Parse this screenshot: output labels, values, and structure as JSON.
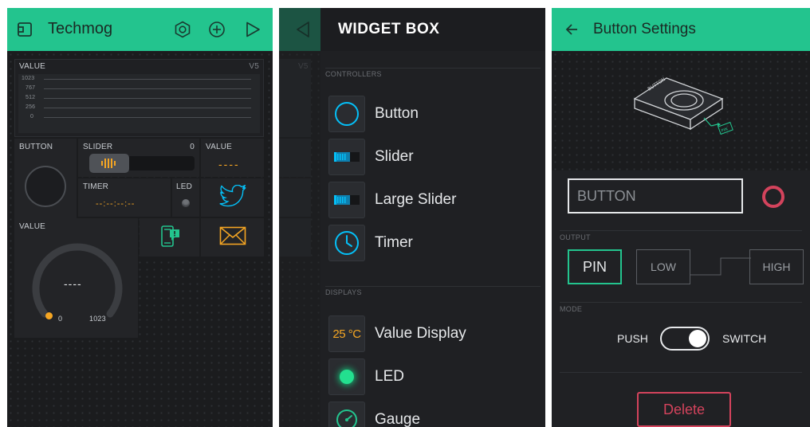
{
  "panel1": {
    "title": "Techmog",
    "value_chart": {
      "label": "VALUE",
      "pin": "V5",
      "ticks": [
        "1023",
        "767",
        "512",
        "256",
        "0"
      ]
    },
    "button_widget": {
      "label": "BUTTON"
    },
    "slider_widget": {
      "label": "SLIDER",
      "value": "0"
    },
    "value_small": {
      "label": "VALUE",
      "value": "----"
    },
    "timer_widget": {
      "label": "TIMER",
      "value": "--:--:--:--"
    },
    "led_widget": {
      "label": "LED"
    },
    "gauge_widget": {
      "label": "VALUE",
      "value": "----",
      "min": "0",
      "max": "1023"
    }
  },
  "panel2": {
    "title": "WIDGET BOX",
    "controllers_label": "CONTROLLERS",
    "controllers": [
      {
        "label": "Button",
        "icon": "circle-outline-icon"
      },
      {
        "label": "Slider",
        "icon": "slider-icon"
      },
      {
        "label": "Large Slider",
        "icon": "large-slider-icon"
      },
      {
        "label": "Timer",
        "icon": "clock-icon"
      }
    ],
    "displays_label": "DISPLAYS",
    "displays": [
      {
        "label": "Value Display",
        "icon": "value-display-icon",
        "icon_text": "25 °C"
      },
      {
        "label": "LED",
        "icon": "led-icon"
      },
      {
        "label": "Gauge",
        "icon": "gauge-icon"
      }
    ],
    "peek": {
      "pin": "V5"
    }
  },
  "panel3": {
    "title": "Button Settings",
    "illustration_labels": {
      "device": "BUTTON",
      "pin": "PIN"
    },
    "name_input": "BUTTON",
    "output_label": "OUTPUT",
    "pin_button": "PIN",
    "low_button": "LOW",
    "high_button": "HIGH",
    "mode_label": "MODE",
    "mode_push": "PUSH",
    "mode_switch": "SWITCH",
    "mode_state": "switch",
    "delete_label": "Delete"
  },
  "colors": {
    "accent_green": "#23c48e",
    "orange": "#f5a623",
    "blue": "#04c0f8",
    "red": "#d3435c",
    "background": "#1b1c1e"
  }
}
